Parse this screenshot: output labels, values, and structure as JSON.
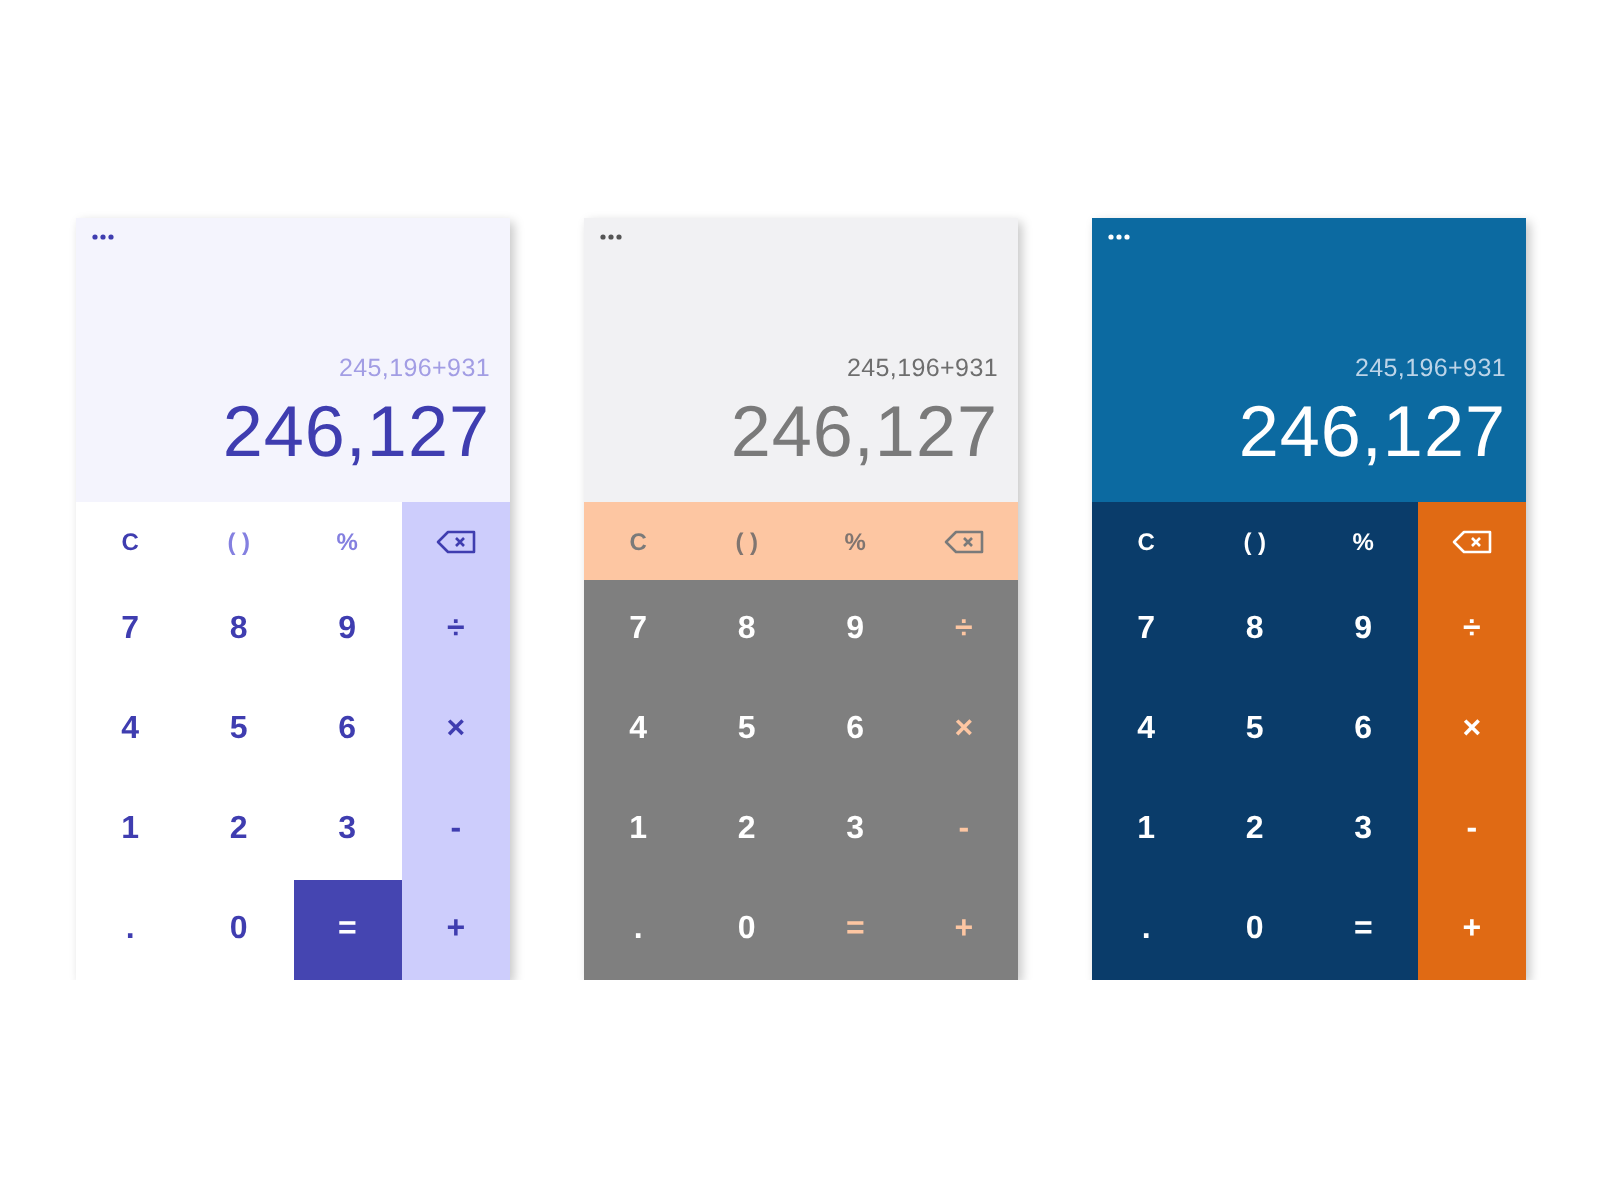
{
  "calculators": [
    {
      "kind": "lavender",
      "expression": "245,196+931",
      "result": "246,127",
      "keys": [
        [
          {
            "kind": "clear",
            "label": "C"
          },
          {
            "kind": "function",
            "label": "( )"
          },
          {
            "kind": "function",
            "label": "%"
          },
          {
            "kind": "backspace"
          }
        ],
        [
          {
            "kind": "digit",
            "label": "7"
          },
          {
            "kind": "digit",
            "label": "8"
          },
          {
            "kind": "digit",
            "label": "9"
          },
          {
            "kind": "operator",
            "label": "÷"
          }
        ],
        [
          {
            "kind": "digit",
            "label": "4"
          },
          {
            "kind": "digit",
            "label": "5"
          },
          {
            "kind": "digit",
            "label": "6"
          },
          {
            "kind": "operator",
            "label": "×"
          }
        ],
        [
          {
            "kind": "digit",
            "label": "1"
          },
          {
            "kind": "digit",
            "label": "2"
          },
          {
            "kind": "digit",
            "label": "3"
          },
          {
            "kind": "operator",
            "label": "-"
          }
        ],
        [
          {
            "kind": "decimal",
            "label": "."
          },
          {
            "kind": "digit",
            "label": "0"
          },
          {
            "kind": "equals",
            "label": "="
          },
          {
            "kind": "operator",
            "label": "+"
          }
        ]
      ]
    },
    {
      "kind": "gray",
      "expression": "245,196+931",
      "result": "246,127",
      "keys": [
        [
          {
            "kind": "clear",
            "label": "C"
          },
          {
            "kind": "function",
            "label": "( )"
          },
          {
            "kind": "function",
            "label": "%"
          },
          {
            "kind": "backspace"
          }
        ],
        [
          {
            "kind": "digit",
            "label": "7"
          },
          {
            "kind": "digit",
            "label": "8"
          },
          {
            "kind": "digit",
            "label": "9"
          },
          {
            "kind": "operator",
            "label": "÷"
          }
        ],
        [
          {
            "kind": "digit",
            "label": "4"
          },
          {
            "kind": "digit",
            "label": "5"
          },
          {
            "kind": "digit",
            "label": "6"
          },
          {
            "kind": "operator",
            "label": "×"
          }
        ],
        [
          {
            "kind": "digit",
            "label": "1"
          },
          {
            "kind": "digit",
            "label": "2"
          },
          {
            "kind": "digit",
            "label": "3"
          },
          {
            "kind": "operator",
            "label": "-"
          }
        ],
        [
          {
            "kind": "decimal",
            "label": "."
          },
          {
            "kind": "digit",
            "label": "0"
          },
          {
            "kind": "equals",
            "label": "="
          },
          {
            "kind": "operator",
            "label": "+"
          }
        ]
      ]
    },
    {
      "kind": "blue",
      "expression": "245,196+931",
      "result": "246,127",
      "keys": [
        [
          {
            "kind": "clear",
            "label": "C"
          },
          {
            "kind": "function",
            "label": "( )"
          },
          {
            "kind": "function",
            "label": "%"
          },
          {
            "kind": "backspace"
          }
        ],
        [
          {
            "kind": "digit",
            "label": "7"
          },
          {
            "kind": "digit",
            "label": "8"
          },
          {
            "kind": "digit",
            "label": "9"
          },
          {
            "kind": "operator",
            "label": "÷"
          }
        ],
        [
          {
            "kind": "digit",
            "label": "4"
          },
          {
            "kind": "digit",
            "label": "5"
          },
          {
            "kind": "digit",
            "label": "6"
          },
          {
            "kind": "operator",
            "label": "×"
          }
        ],
        [
          {
            "kind": "digit",
            "label": "1"
          },
          {
            "kind": "digit",
            "label": "2"
          },
          {
            "kind": "digit",
            "label": "3"
          },
          {
            "kind": "operator",
            "label": "-"
          }
        ],
        [
          {
            "kind": "decimal",
            "label": "."
          },
          {
            "kind": "digit",
            "label": "0"
          },
          {
            "kind": "equals",
            "label": "="
          },
          {
            "kind": "operator",
            "label": "+"
          }
        ]
      ]
    }
  ]
}
